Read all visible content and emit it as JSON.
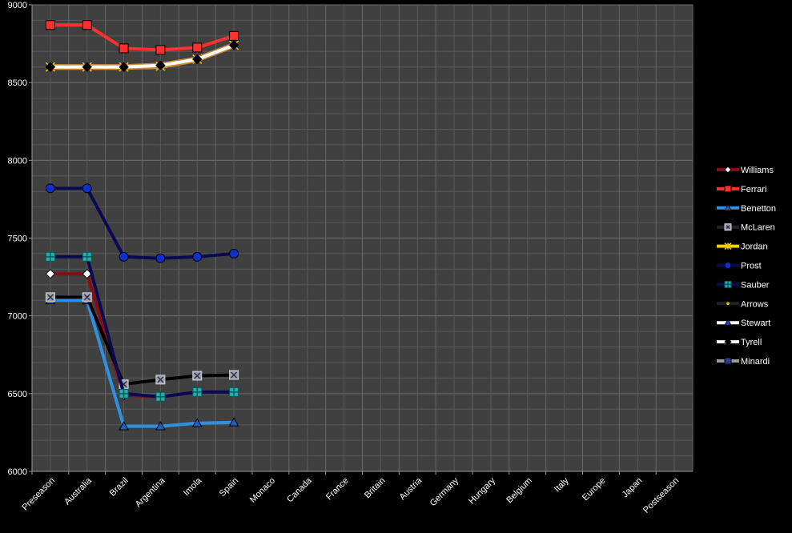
{
  "chart_data": {
    "type": "line",
    "title": "",
    "xlabel": "",
    "ylabel": "",
    "ylim": [
      6000,
      9000
    ],
    "y_ticks": [
      6000,
      6500,
      7000,
      7500,
      8000,
      8500,
      9000
    ],
    "y_tick_labels": [
      "6000",
      "6500",
      "7000",
      "7500",
      "8000",
      "8500",
      "9000"
    ],
    "grid": true,
    "legend_position": "right",
    "background": "#404040",
    "categories": [
      "Preseason",
      "Australia",
      "Brazil",
      "Argentina",
      "Imola",
      "Spain",
      "Monaco",
      "Canada",
      "France",
      "Britain",
      "Austria",
      "Germany",
      "Hungary",
      "Belgium",
      "Italy",
      "Europe",
      "Japan",
      "Postseason"
    ],
    "series": [
      {
        "name": "Williams",
        "color": "#8b0a14",
        "marker": "diamond",
        "marker_fill": "#ffffff",
        "values": [
          7270,
          7270,
          6490,
          6480,
          6510,
          6510,
          null,
          null,
          null,
          null,
          null,
          null,
          null,
          null,
          null,
          null,
          null,
          null
        ]
      },
      {
        "name": "Ferrari",
        "color": "#ff3030",
        "marker": "square",
        "marker_fill": "#ff3030",
        "values": [
          8870,
          8870,
          8720,
          8710,
          8725,
          8800,
          null,
          null,
          null,
          null,
          null,
          null,
          null,
          null,
          null,
          null,
          null,
          null
        ]
      },
      {
        "name": "Benetton",
        "color": "#2f8fe0",
        "marker": "triangle",
        "marker_fill": "#2060c0",
        "values": [
          7100,
          7100,
          6290,
          6290,
          6310,
          6315,
          null,
          null,
          null,
          null,
          null,
          null,
          null,
          null,
          null,
          null,
          null,
          null
        ]
      },
      {
        "name": "McLaren",
        "color": "#000000",
        "marker": "xsquare",
        "marker_fill": "#9aa0b8",
        "values": [
          7120,
          7120,
          6560,
          6590,
          6615,
          6620,
          null,
          null,
          null,
          null,
          null,
          null,
          null,
          null,
          null,
          null,
          null,
          null
        ]
      },
      {
        "name": "Jordan",
        "color": "#f5d000",
        "marker": "star",
        "marker_fill": "#f5d000",
        "values": [
          8600,
          8600,
          8600,
          8605,
          8650,
          8740,
          null,
          null,
          null,
          null,
          null,
          null,
          null,
          null,
          null,
          null,
          null,
          null
        ]
      },
      {
        "name": "Prost",
        "color": "#0a0a50",
        "marker": "circle",
        "marker_fill": "#1030c8",
        "values": [
          7820,
          7820,
          7380,
          7370,
          7380,
          7400,
          null,
          null,
          null,
          null,
          null,
          null,
          null,
          null,
          null,
          null,
          null,
          null
        ]
      },
      {
        "name": "Sauber",
        "color": "#0a0a50",
        "marker": "plussquare",
        "marker_fill": "#20b0b0",
        "values": [
          7380,
          7380,
          6500,
          6480,
          6510,
          6510,
          null,
          null,
          null,
          null,
          null,
          null,
          null,
          null,
          null,
          null,
          null,
          null
        ]
      },
      {
        "name": "Arrows",
        "color": "#000000",
        "marker": "dot",
        "marker_fill": "#f0c000",
        "values": [
          null,
          null,
          null,
          null,
          null,
          null,
          null,
          null,
          null,
          null,
          null,
          null,
          null,
          null,
          null,
          null,
          null,
          null
        ]
      },
      {
        "name": "Stewart",
        "color": "#ffffff",
        "marker": "triangle",
        "marker_fill": "#2040d0",
        "values": [
          null,
          null,
          null,
          null,
          null,
          null,
          null,
          null,
          null,
          null,
          null,
          null,
          null,
          null,
          null,
          null,
          null,
          null
        ]
      },
      {
        "name": "Tyrell",
        "color": "#ffffff",
        "marker": "diamond",
        "marker_fill": "#000000",
        "values": [
          8600,
          8600,
          8600,
          8610,
          8650,
          8740,
          null,
          null,
          null,
          null,
          null,
          null,
          null,
          null,
          null,
          null,
          null,
          null
        ]
      },
      {
        "name": "Minardi",
        "color": "#9a9a9a",
        "marker": "square",
        "marker_fill": "#2a3a8a",
        "values": [
          null,
          null,
          null,
          null,
          null,
          null,
          null,
          null,
          null,
          null,
          null,
          null,
          null,
          null,
          null,
          null,
          null,
          null
        ]
      }
    ]
  }
}
